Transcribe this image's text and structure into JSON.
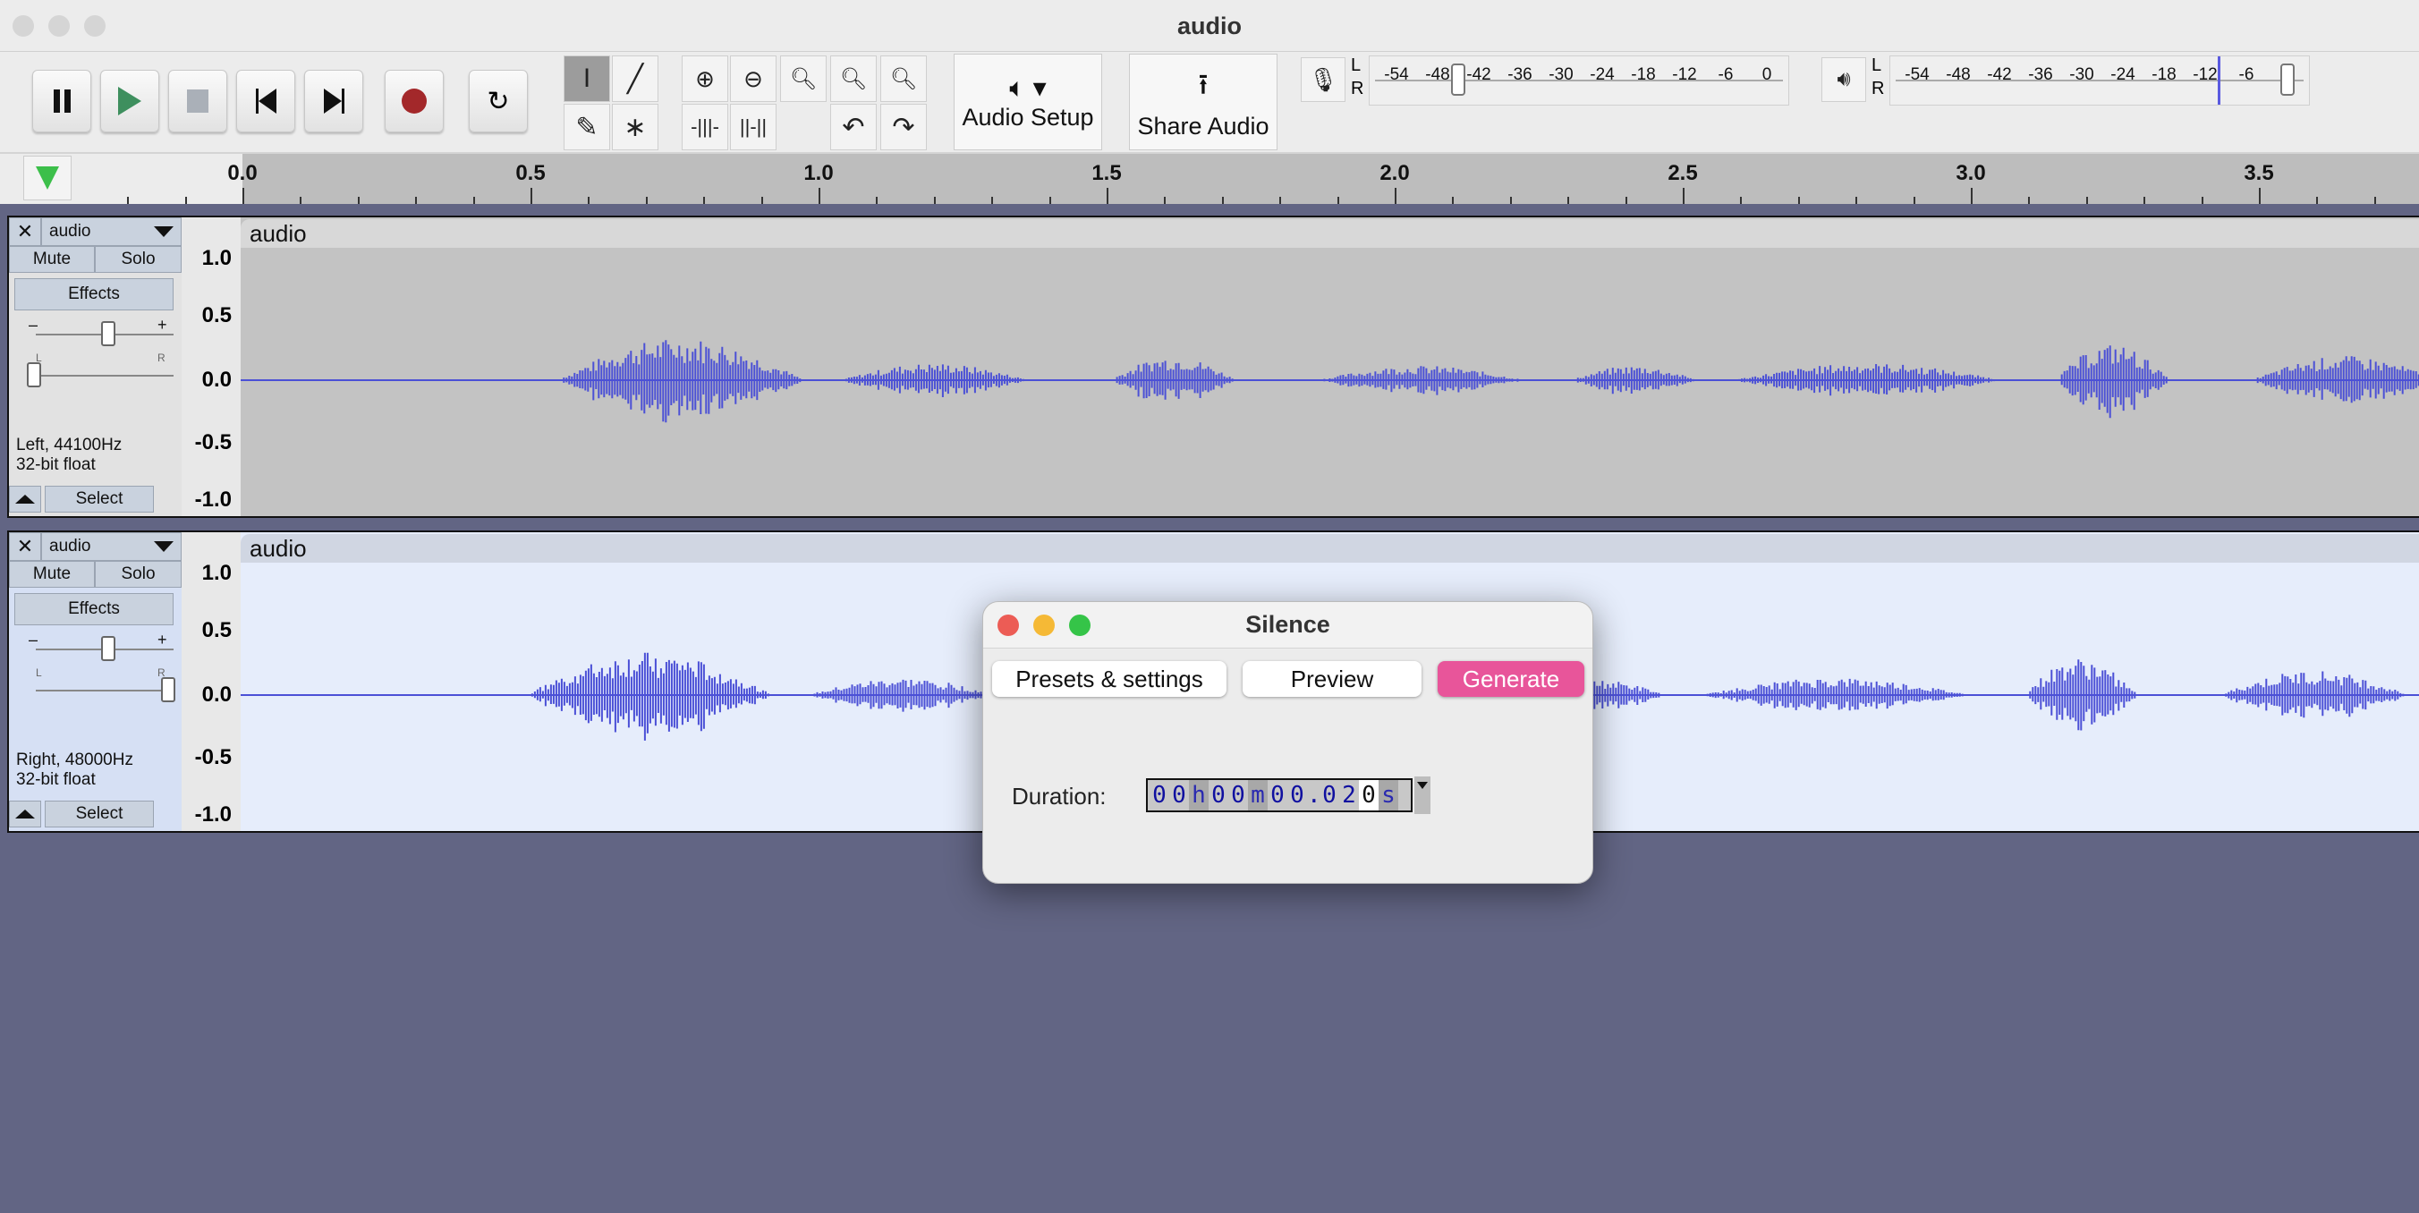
{
  "window": {
    "title": "audio"
  },
  "toolbar": {
    "audio_setup_label": "Audio Setup",
    "share_audio_label": "Share Audio",
    "record_meter": {
      "channels": [
        "L",
        "R"
      ],
      "ticks": [
        "-54",
        "-48",
        "-42",
        "-36",
        "-30",
        "-24",
        "-18",
        "-12",
        "-6",
        "0"
      ],
      "level_db": -45
    },
    "play_meter": {
      "channels": [
        "L",
        "R"
      ],
      "ticks": [
        "-54",
        "-48",
        "-42",
        "-36",
        "-30",
        "-24",
        "-18",
        "-12",
        "-6",
        "0"
      ],
      "level_db": 0
    }
  },
  "ruler": {
    "ticks": [
      "0.0",
      "0.5",
      "1.0",
      "1.5",
      "2.0",
      "2.5",
      "3.0",
      "3.5"
    ]
  },
  "tracks": [
    {
      "name": "audio",
      "mute": "Mute",
      "solo": "Solo",
      "effects": "Effects",
      "info1": "Left, 44100Hz",
      "info2": "32-bit float",
      "select": "Select",
      "clip": "audio",
      "gain": 0.5,
      "pan": -1,
      "selected": false,
      "scale": [
        "1.0",
        "0.5",
        "0.0",
        "-0.5",
        "-1.0"
      ]
    },
    {
      "name": "audio",
      "mute": "Mute",
      "solo": "Solo",
      "effects": "Effects",
      "info1": "Right, 48000Hz",
      "info2": "32-bit float",
      "select": "Select",
      "clip": "audio",
      "gain": 0.5,
      "pan": 1,
      "selected": true,
      "scale": [
        "1.0",
        "0.5",
        "0.0",
        "-0.5",
        "-1.0"
      ]
    }
  ],
  "dialog": {
    "title": "Silence",
    "presets": "Presets & settings",
    "preview": "Preview",
    "generate": "Generate",
    "duration_label": "Duration:",
    "duration_value": [
      "0",
      "0",
      "h",
      "0",
      "0",
      "m",
      "0",
      "0",
      ".",
      "0",
      "2",
      "0",
      "s"
    ]
  },
  "colors": {
    "accent": "#e8559a",
    "waveform": "#4b50d6",
    "selected_track": "#e6edfb",
    "unselected_track": "#c3c3c3",
    "background": "#626584"
  }
}
